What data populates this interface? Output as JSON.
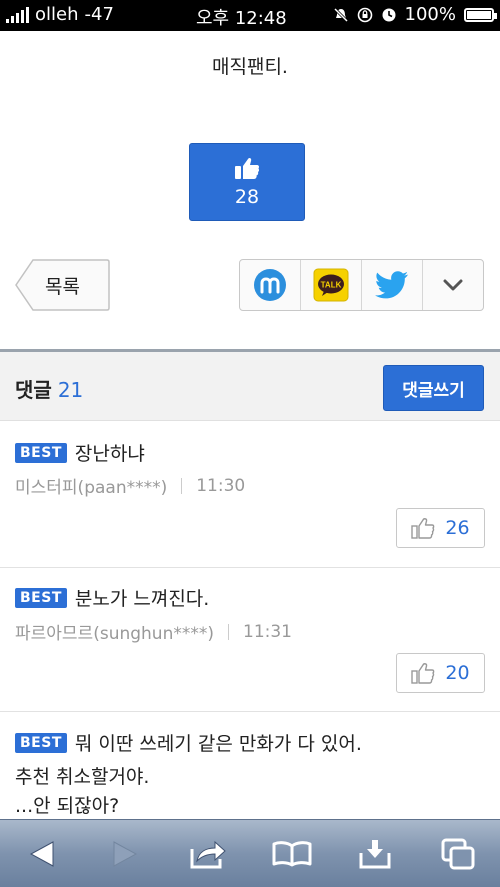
{
  "status": {
    "carrier": "olleh",
    "signal_db": "-47",
    "time": "오후 12:48",
    "battery": "100%",
    "battery_level": 1.0
  },
  "article": {
    "text": "매직팬티.",
    "like_count": "28"
  },
  "nav": {
    "list_label": "목록"
  },
  "share": {
    "items": [
      "mypeople-icon",
      "kakaotalk-icon",
      "twitter-icon",
      "chevron-down-icon"
    ],
    "kakao_label": "TALK"
  },
  "comments": {
    "title": "댓글",
    "count": "21",
    "write_label": "댓글쓰기",
    "items": [
      {
        "badge": "BEST",
        "text": "장난하냐",
        "author": "미스터피(paan****)",
        "time": "11:30",
        "likes": "26"
      },
      {
        "badge": "BEST",
        "text": "분노가 느껴진다.",
        "author": "파르아므르(sunghun****)",
        "time": "11:31",
        "likes": "20"
      },
      {
        "badge": "BEST",
        "text": "뭐 이딴 쓰레기 같은 만화가 다 있어.",
        "line2": "추천 취소할거야.",
        "line3": "...안 되잖아?"
      }
    ]
  },
  "toolbar": {
    "items": [
      "back-icon",
      "forward-icon",
      "share-icon",
      "bookmarks-icon",
      "download-icon",
      "tabs-icon"
    ]
  }
}
